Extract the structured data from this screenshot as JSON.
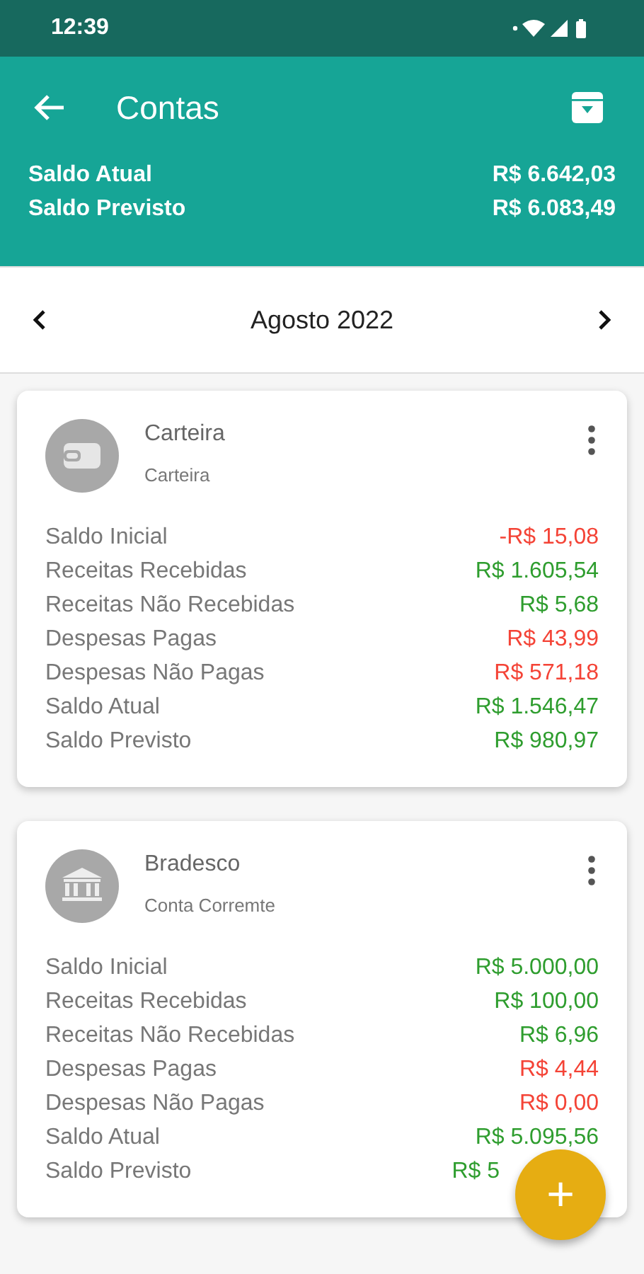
{
  "status_bar": {
    "time": "12:39"
  },
  "app_bar": {
    "title": "Contas"
  },
  "summary": [
    {
      "label": "Saldo Atual",
      "value": "R$ 6.642,03"
    },
    {
      "label": "Saldo Previsto",
      "value": "R$ 6.083,49"
    }
  ],
  "month": {
    "label": "Agosto 2022"
  },
  "accounts": [
    {
      "name": "Carteira",
      "type": "Carteira",
      "kind": "wallet",
      "rows": [
        {
          "label": "Saldo Inicial",
          "value": "-R$ 15,08",
          "color": "#f44336"
        },
        {
          "label": "Receitas Recebidas",
          "value": "R$ 1.605,54",
          "color": "#2e9d2e"
        },
        {
          "label": "Receitas Não Recebidas",
          "value": "R$ 5,68",
          "color": "#2e9d2e"
        },
        {
          "label": "Despesas Pagas",
          "value": "R$ 43,99",
          "color": "#f44336"
        },
        {
          "label": "Despesas Não Pagas",
          "value": "R$ 571,18",
          "color": "#f44336"
        },
        {
          "label": "Saldo Atual",
          "value": "R$ 1.546,47",
          "color": "#2e9d2e"
        },
        {
          "label": "Saldo Previsto",
          "value": "R$ 980,97",
          "color": "#2e9d2e"
        }
      ]
    },
    {
      "name": "Bradesco",
      "type": "Conta Corremte",
      "kind": "bank",
      "rows": [
        {
          "label": "Saldo Inicial",
          "value": "R$ 5.000,00",
          "color": "#2e9d2e"
        },
        {
          "label": "Receitas Recebidas",
          "value": "R$ 100,00",
          "color": "#2e9d2e"
        },
        {
          "label": "Receitas Não Recebidas",
          "value": "R$ 6,96",
          "color": "#2e9d2e"
        },
        {
          "label": "Despesas Pagas",
          "value": "R$ 4,44",
          "color": "#f44336"
        },
        {
          "label": "Despesas Não Pagas",
          "value": "R$ 0,00",
          "color": "#f44336"
        },
        {
          "label": "Saldo Atual",
          "value": "R$ 5.095,56",
          "color": "#2e9d2e"
        },
        {
          "label": "Saldo Previsto",
          "value": "R$ 5",
          "color": "#2e9d2e"
        }
      ]
    }
  ],
  "fab": {
    "label": "+"
  }
}
